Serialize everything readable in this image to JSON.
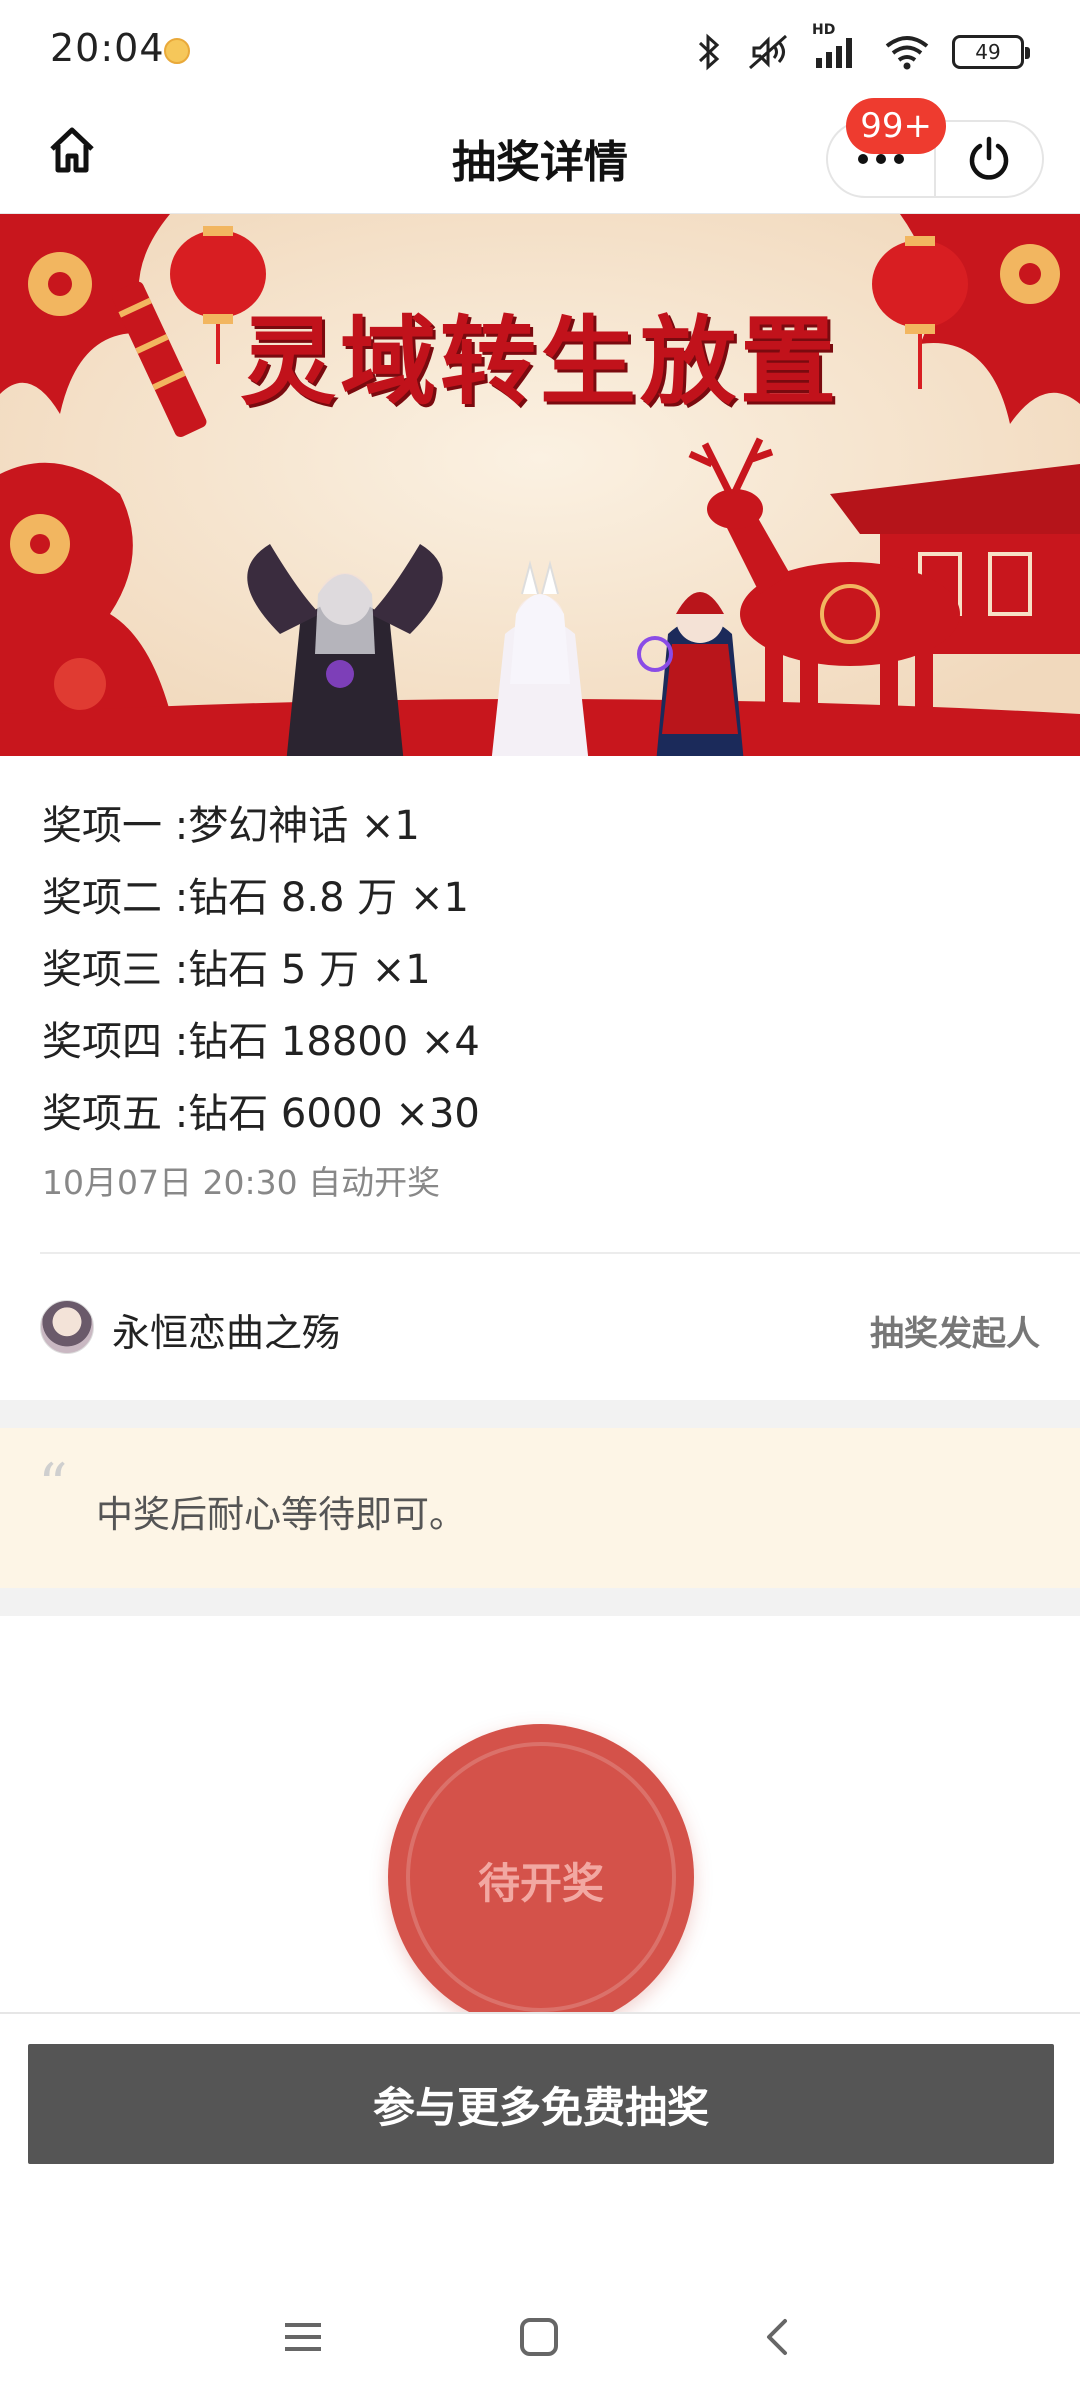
{
  "status_bar": {
    "time": "20:04",
    "icons": [
      "emoji-icon",
      "bluetooth-icon",
      "mute-icon",
      "signal-icon",
      "wifi-icon"
    ],
    "signal_label": "HD",
    "battery": "49"
  },
  "nav": {
    "title": "抽奖详情",
    "badge": "99+",
    "icons": [
      "home-icon",
      "more-icon",
      "power-icon"
    ]
  },
  "banner": {
    "title": "灵域转生放置"
  },
  "prizes": [
    {
      "label": "奖项一 :",
      "content": "梦幻神话 ×1"
    },
    {
      "label": "奖项二 :",
      "content": "钻石 8.8 万 ×1"
    },
    {
      "label": "奖项三 :",
      "content": "钻石 5 万 ×1"
    },
    {
      "label": "奖项四 :",
      "content": "钻石 18800 ×4"
    },
    {
      "label": "奖项五 :",
      "content": "钻石 6000 ×30"
    }
  ],
  "draw_time": "10月07日 20:30 自动开奖",
  "initiator": {
    "name": "永恒恋曲之殇",
    "role": "抽奖发起人"
  },
  "note": {
    "quote": "“",
    "text": "中奖后耐心等待即可。"
  },
  "draw_button": {
    "label": "待开奖"
  },
  "more_button": {
    "label": "参与更多免费抽奖"
  },
  "colors": {
    "accent_red": "#d4524a",
    "badge_red": "#ee3b2f",
    "note_bg": "#fdf5e6",
    "button_gray": "#555555"
  },
  "system_nav": {
    "icons": [
      "menu-icon",
      "home-square-icon",
      "back-icon"
    ]
  }
}
